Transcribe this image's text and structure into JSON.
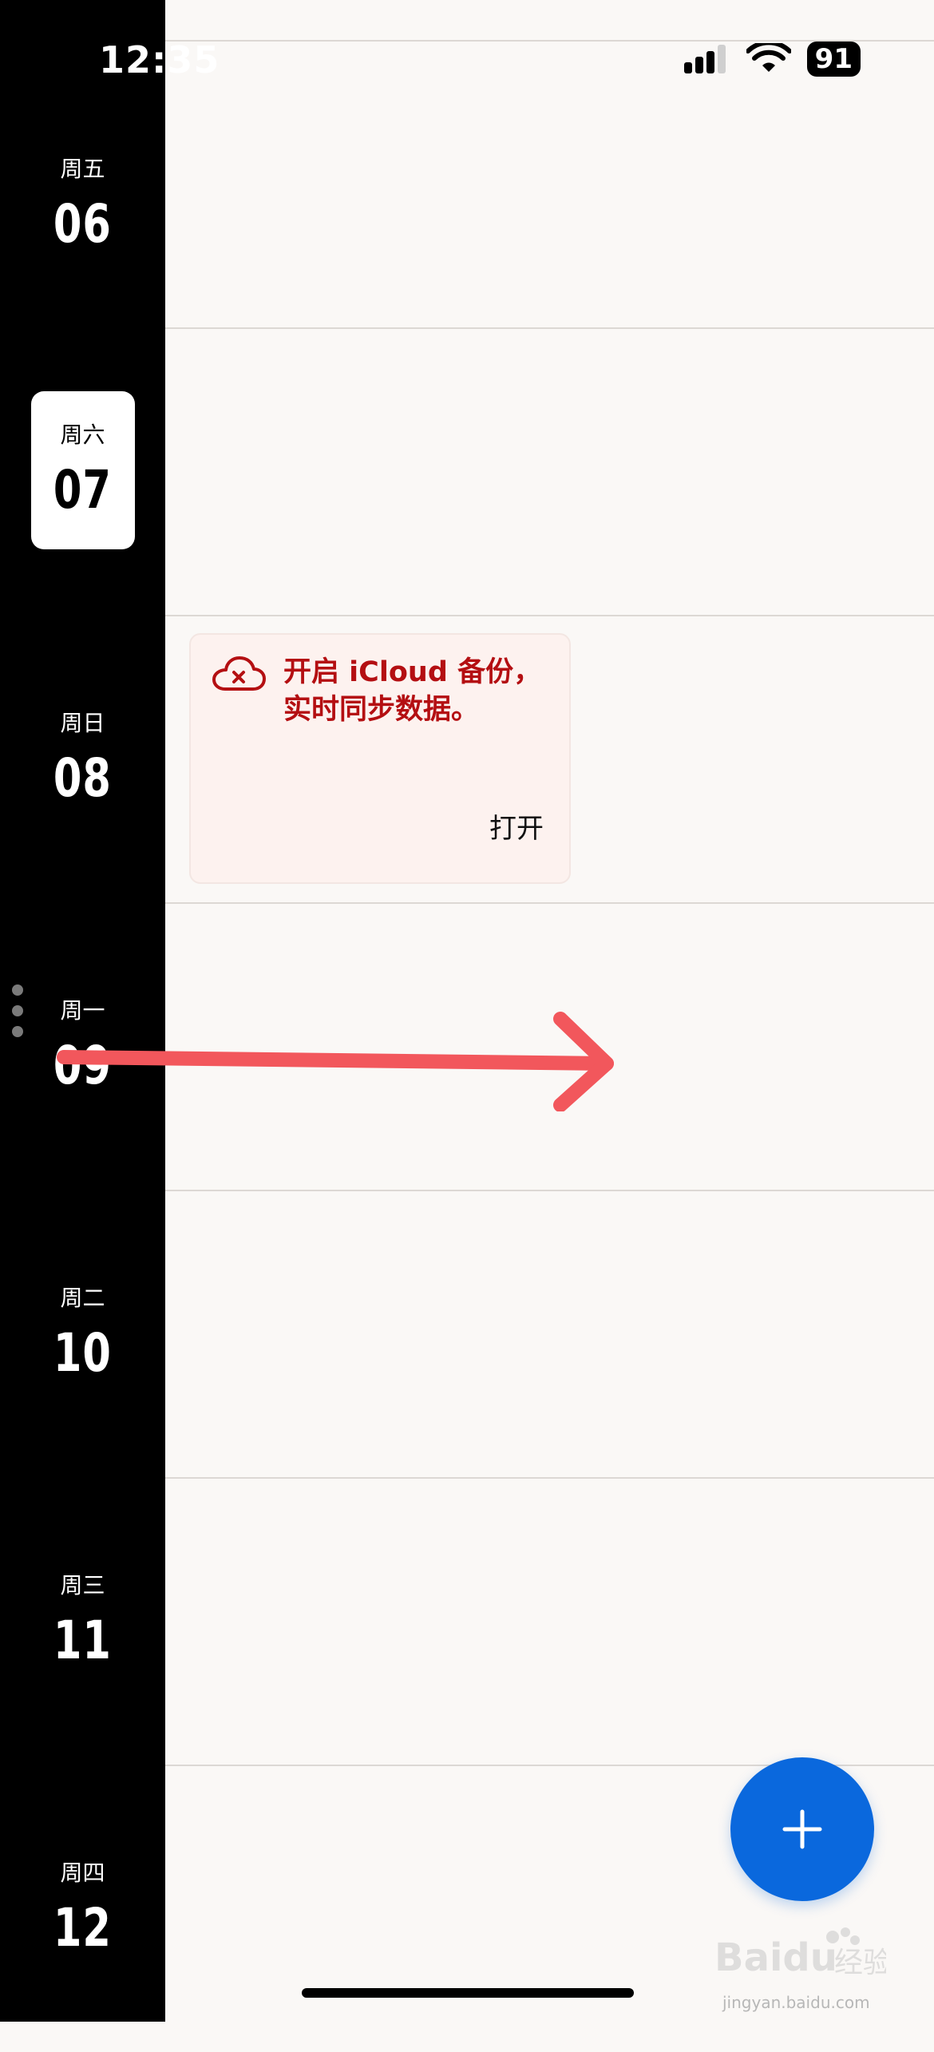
{
  "status_bar": {
    "time": "12:35",
    "battery": "91"
  },
  "days": [
    {
      "weekday": "周五",
      "date": "06",
      "selected": false
    },
    {
      "weekday": "周六",
      "date": "07",
      "selected": true
    },
    {
      "weekday": "周日",
      "date": "08",
      "selected": false
    },
    {
      "weekday": "周一",
      "date": "09",
      "selected": false
    },
    {
      "weekday": "周二",
      "date": "10",
      "selected": false
    },
    {
      "weekday": "周三",
      "date": "11",
      "selected": false
    },
    {
      "weekday": "周四",
      "date": "12",
      "selected": false
    }
  ],
  "icloud_card": {
    "icon": "cloud-error-icon",
    "message": "开启 iCloud 备份，实时同步数据。",
    "action_label": "打开"
  },
  "fab": {
    "icon": "plus-icon"
  },
  "annotation": {
    "arrow_color": "#f2575c"
  },
  "watermark": {
    "url": "jingyan.baidu.com"
  },
  "colors": {
    "rail_background": "#000000",
    "content_background": "#faf8f6",
    "fab_blue": "#0a68dd",
    "icloud_red": "#b40f12"
  }
}
